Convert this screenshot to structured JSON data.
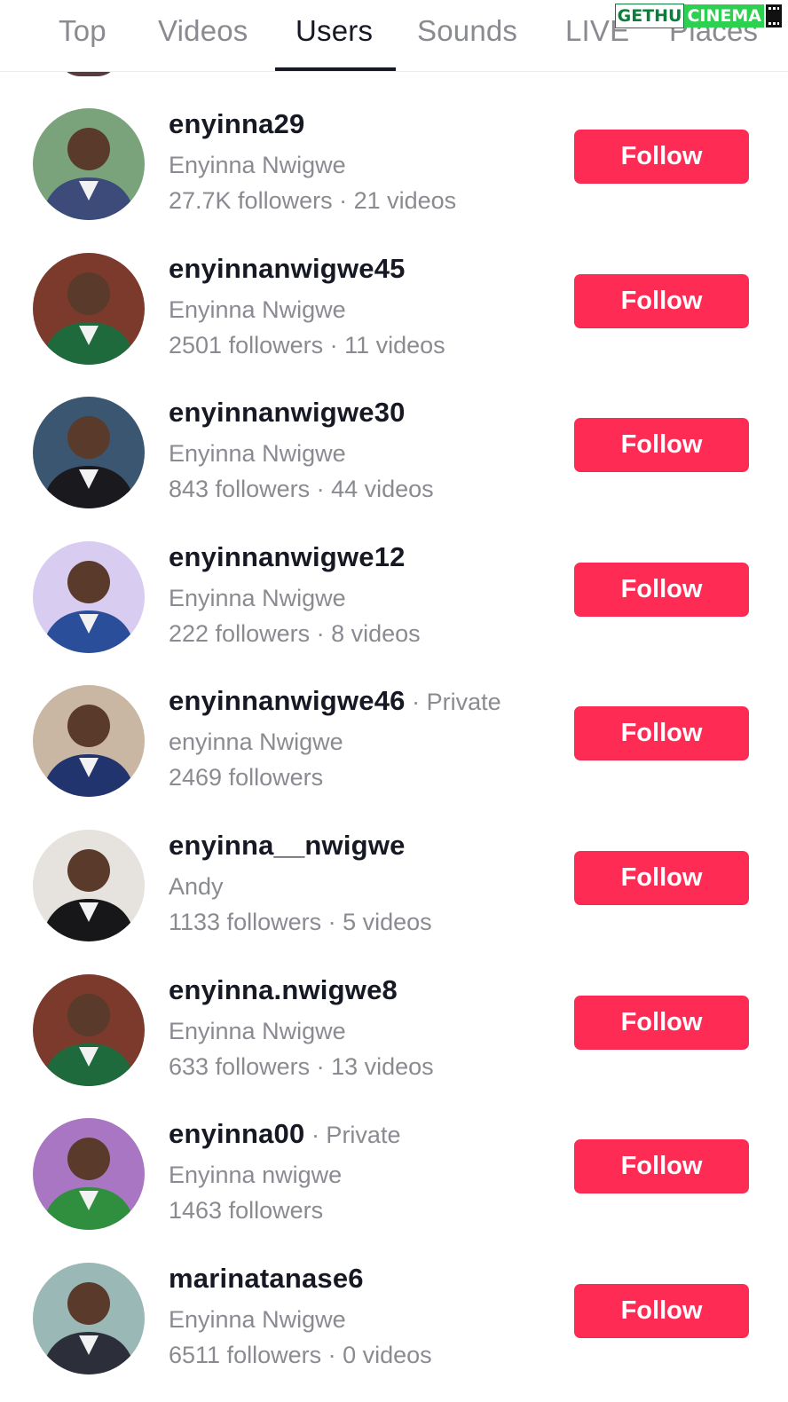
{
  "tabs": [
    {
      "label": "Top",
      "active": false
    },
    {
      "label": "Videos",
      "active": false
    },
    {
      "label": "Users",
      "active": true
    },
    {
      "label": "Sounds",
      "active": false
    },
    {
      "label": "LIVE",
      "active": false
    },
    {
      "label": "Places",
      "active": false
    }
  ],
  "watermark": {
    "part1": "GETHU",
    "part2": "CINEMA"
  },
  "colors": {
    "accent": "#fe2c55",
    "primary_text": "#161823",
    "secondary_text": "#8a8b91"
  },
  "users": [
    {
      "username": "enyinna29",
      "private": "",
      "display_name": "Enyinna Nwigwe",
      "stats": "27.7K followers · 21 videos",
      "follow_label": "Follow",
      "avatar_bg": "#7aa37c",
      "avatar_fg": "#3c4b7a"
    },
    {
      "username": "enyinnanwigwe45",
      "private": "",
      "display_name": "Enyinna Nwigwe",
      "stats": "2501 followers · 11 videos",
      "follow_label": "Follow",
      "avatar_bg": "#7b3a2c",
      "avatar_fg": "#1f6a3c"
    },
    {
      "username": "enyinnanwigwe30",
      "private": "",
      "display_name": "Enyinna Nwigwe",
      "stats": "843 followers · 44 videos",
      "follow_label": "Follow",
      "avatar_bg": "#3b5670",
      "avatar_fg": "#1a1a1e"
    },
    {
      "username": "enyinnanwigwe12",
      "private": "",
      "display_name": "Enyinna Nwigwe",
      "stats": "222 followers · 8 videos",
      "follow_label": "Follow",
      "avatar_bg": "#d8ccf0",
      "avatar_fg": "#2a4e9a"
    },
    {
      "username": "enyinnanwigwe46",
      "private": " · Private",
      "display_name": "enyinna Nwigwe",
      "stats": "2469 followers",
      "follow_label": "Follow",
      "avatar_bg": "#c9b6a3",
      "avatar_fg": "#22346e"
    },
    {
      "username": "enyinna__nwigwe",
      "private": "",
      "display_name": "Andy",
      "stats": "1133 followers · 5 videos",
      "follow_label": "Follow",
      "avatar_bg": "#e6e2dd",
      "avatar_fg": "#17171a"
    },
    {
      "username": "enyinna.nwigwe8",
      "private": "",
      "display_name": "Enyinna Nwigwe",
      "stats": "633 followers · 13 videos",
      "follow_label": "Follow",
      "avatar_bg": "#7b3a2c",
      "avatar_fg": "#1f6a3c"
    },
    {
      "username": "enyinna00",
      "private": " · Private",
      "display_name": "Enyinna nwigwe",
      "stats": "1463 followers",
      "follow_label": "Follow",
      "avatar_bg": "#a876c2",
      "avatar_fg": "#2f8f3e"
    },
    {
      "username": "marinatanase6",
      "private": "",
      "display_name": "Enyinna Nwigwe",
      "stats": "6511 followers · 0 videos",
      "follow_label": "Follow",
      "avatar_bg": "#9ab8b5",
      "avatar_fg": "#2c2e3a"
    }
  ]
}
